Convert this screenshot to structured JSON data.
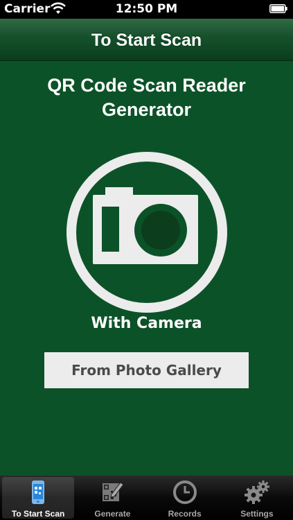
{
  "status_bar": {
    "carrier": "Carrier",
    "time": "12:50 PM"
  },
  "nav": {
    "title": "To Start Scan"
  },
  "main": {
    "app_title_line1": "QR Code Scan Reader",
    "app_title_line2": "Generator",
    "camera_label": "With Camera",
    "gallery_button": "From Photo Gallery"
  },
  "tabs": [
    {
      "label": "To Start Scan",
      "icon": "phone-icon",
      "active": true
    },
    {
      "label": "Generate",
      "icon": "qr-pencil-icon",
      "active": false
    },
    {
      "label": "Records",
      "icon": "clock-icon",
      "active": false
    },
    {
      "label": "Settings",
      "icon": "gears-icon",
      "active": false
    }
  ],
  "colors": {
    "background": "#0c5228",
    "nav_bar": "#15502b",
    "camera_icon": "#ececec",
    "lens": "#0c3d1c",
    "button_bg": "#ececec",
    "button_text": "#4a4a4a"
  }
}
